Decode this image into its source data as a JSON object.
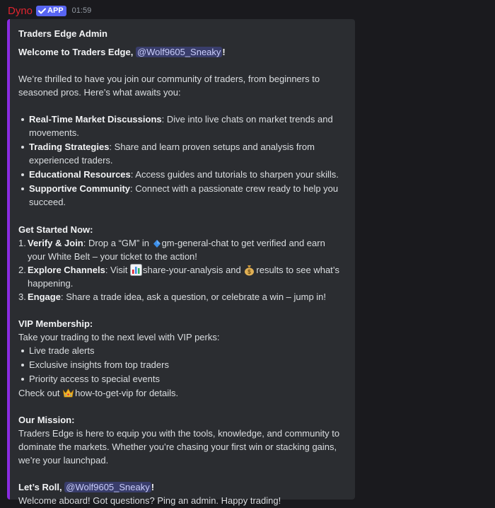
{
  "message": {
    "username": "Dyno",
    "badge": "APP",
    "timestamp": "01:59"
  },
  "embed": {
    "author": "Traders Edge Admin",
    "welcome_prefix": "Welcome to Traders Edge,",
    "mention": "@Wolf9605_Sneaky",
    "welcome_suffix": "!",
    "intro": "We’re thrilled to have you join our community of traders, from beginners to seasoned pros. Here’s what awaits you:",
    "features": [
      {
        "title": "Real-Time Market Discussions",
        "text": ": Dive into live chats on market trends and movements."
      },
      {
        "title": "Trading Strategies",
        "text": ": Share and learn proven setups and analysis from experienced traders."
      },
      {
        "title": "Educational Resources",
        "text": ": Access guides and tutorials to sharpen your skills."
      },
      {
        "title": "Supportive Community",
        "text": ": Connect with a passionate crew ready to help you succeed."
      }
    ],
    "get_started_heading": "Get Started Now:",
    "steps": {
      "s1_num": "1.",
      "s1_title": "Verify & Join",
      "s1_a": ": Drop a “GM” in",
      "s1_channel": "gm-general-chat",
      "s1_b": "to get verified and earn your White Belt – your ticket to the action!",
      "s2_num": "2.",
      "s2_title": "Explore Channels",
      "s2_a": ": Visit",
      "s2_channel1": "share-your-analysis",
      "s2_and": "and",
      "s2_channel2": "results",
      "s2_b": "to see what’s happening.",
      "s3_num": "3.",
      "s3_title": "Engage",
      "s3_text": ": Share a trade idea, ask a question, or celebrate a win – jump in!"
    },
    "vip_heading": "VIP Membership:",
    "vip_intro": "Take your trading to the next level with VIP perks:",
    "vip_perks": [
      "Live trade alerts",
      "Exclusive insights from top traders",
      "Priority access to special events"
    ],
    "vip_check_prefix": "Check out",
    "vip_channel": "how-to-get-vip",
    "vip_check_suffix": "for details.",
    "mission_heading": "Our Mission:",
    "mission_text": "Traders Edge is here to equip you with the tools, knowledge, and community to dominate the markets. Whether you’re chasing your first win or stacking gains, we’re your launchpad.",
    "closing_prefix": "Let’s Roll,",
    "closing_mention": "@Wolf9605_Sneaky",
    "closing_suffix": "!",
    "closing_text": "Welcome aboard! Got questions? Ping an admin. Happy trading!"
  },
  "colors": {
    "username": "#e0242f",
    "badge": "#5865f2",
    "embed_accent": "#8a2be2",
    "mention_bg": "#3c4270",
    "background": "#1a1a1e"
  },
  "icons": [
    "verified-check-icon",
    "diamond-icon",
    "chart-emoji-icon",
    "money-bag-emoji-icon",
    "crown-emoji-icon"
  ]
}
